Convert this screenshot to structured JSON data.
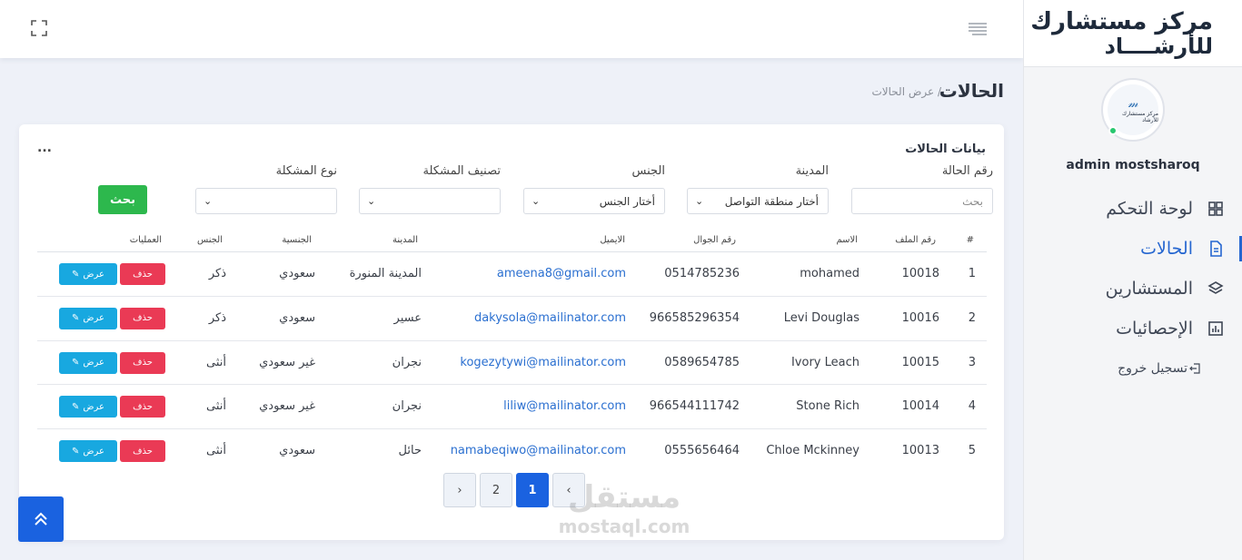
{
  "sidebar": {
    "logo_line1": "مركز مستشارك",
    "logo_line2": "للأرشــــاد",
    "avatar_text": "مركز مستشارك للأرشاد",
    "username": "admin mostsharoq",
    "items": [
      {
        "label": "لوحة التحكم",
        "icon": "dashboard-grid-icon",
        "active": false
      },
      {
        "label": "الحالات",
        "icon": "document-icon",
        "active": true
      },
      {
        "label": "المستشارين",
        "icon": "layers-icon",
        "active": false
      },
      {
        "label": "الإحصائيات",
        "icon": "bar-chart-icon",
        "active": false
      }
    ],
    "logout_label": "تسجيل خروج"
  },
  "header": {
    "title": "الحالات",
    "breadcrumb": "/ عرض الحالات"
  },
  "card": {
    "title": "بيانات الحالات",
    "more": "...",
    "filters": {
      "case_number_label": "رقم الحالة",
      "case_number_placeholder": "بحث",
      "city_label": "المدينة",
      "city_value": "أختار منطقة التواصل",
      "gender_label": "الجنس",
      "gender_value": "أختار الجنس",
      "classification_label": "تصنيف المشكلة",
      "classification_value": "",
      "problem_type_label": "نوع المشكلة",
      "problem_type_value": "",
      "search_button": "بحث"
    },
    "table": {
      "headers": {
        "index": "#",
        "file_no": "رقم الملف",
        "name": "الاسم",
        "mobile": "رقم الجوال",
        "email": "الايميل",
        "city": "المدينة",
        "nationality": "الجنسية",
        "gender": "الجنس",
        "actions": "العمليات"
      },
      "rows": [
        {
          "index": "1",
          "file_no": "10018",
          "name": "mohamed",
          "mobile": "0514785236",
          "email": "ameena8@gmail.com",
          "city": "المدينة المنورة",
          "nationality": "سعودي",
          "gender": "ذكر"
        },
        {
          "index": "2",
          "file_no": "10016",
          "name": "Levi Douglas",
          "mobile": "966585296354",
          "email": "dakysola@mailinator.com",
          "city": "عسير",
          "nationality": "سعودي",
          "gender": "ذكر"
        },
        {
          "index": "3",
          "file_no": "10015",
          "name": "Ivory Leach",
          "mobile": "0589654785",
          "email": "kogezytywi@mailinator.com",
          "city": "نجران",
          "nationality": "غير سعودي",
          "gender": "أنثى"
        },
        {
          "index": "4",
          "file_no": "10014",
          "name": "Stone Rich",
          "mobile": "966544111742",
          "email": "liliw@mailinator.com",
          "city": "نجران",
          "nationality": "غير سعودي",
          "gender": "أنثى"
        },
        {
          "index": "5",
          "file_no": "10013",
          "name": "Chloe Mckinney",
          "mobile": "0555656464",
          "email": "namabeqiwo@mailinator.com",
          "city": "حائل",
          "nationality": "سعودي",
          "gender": "أنثى"
        }
      ],
      "delete_label": "حذف",
      "view_label": "عرض"
    },
    "pagination": {
      "prev": "‹",
      "pages": [
        "1",
        "2"
      ],
      "active_page": "1",
      "next": "›"
    }
  },
  "watermark": {
    "arabic": "مستقل",
    "latin": "mostaql.com"
  },
  "colors": {
    "primary": "#1a62e0",
    "success": "#2db84d",
    "danger": "#ea3a55",
    "info": "#18a8e0"
  }
}
